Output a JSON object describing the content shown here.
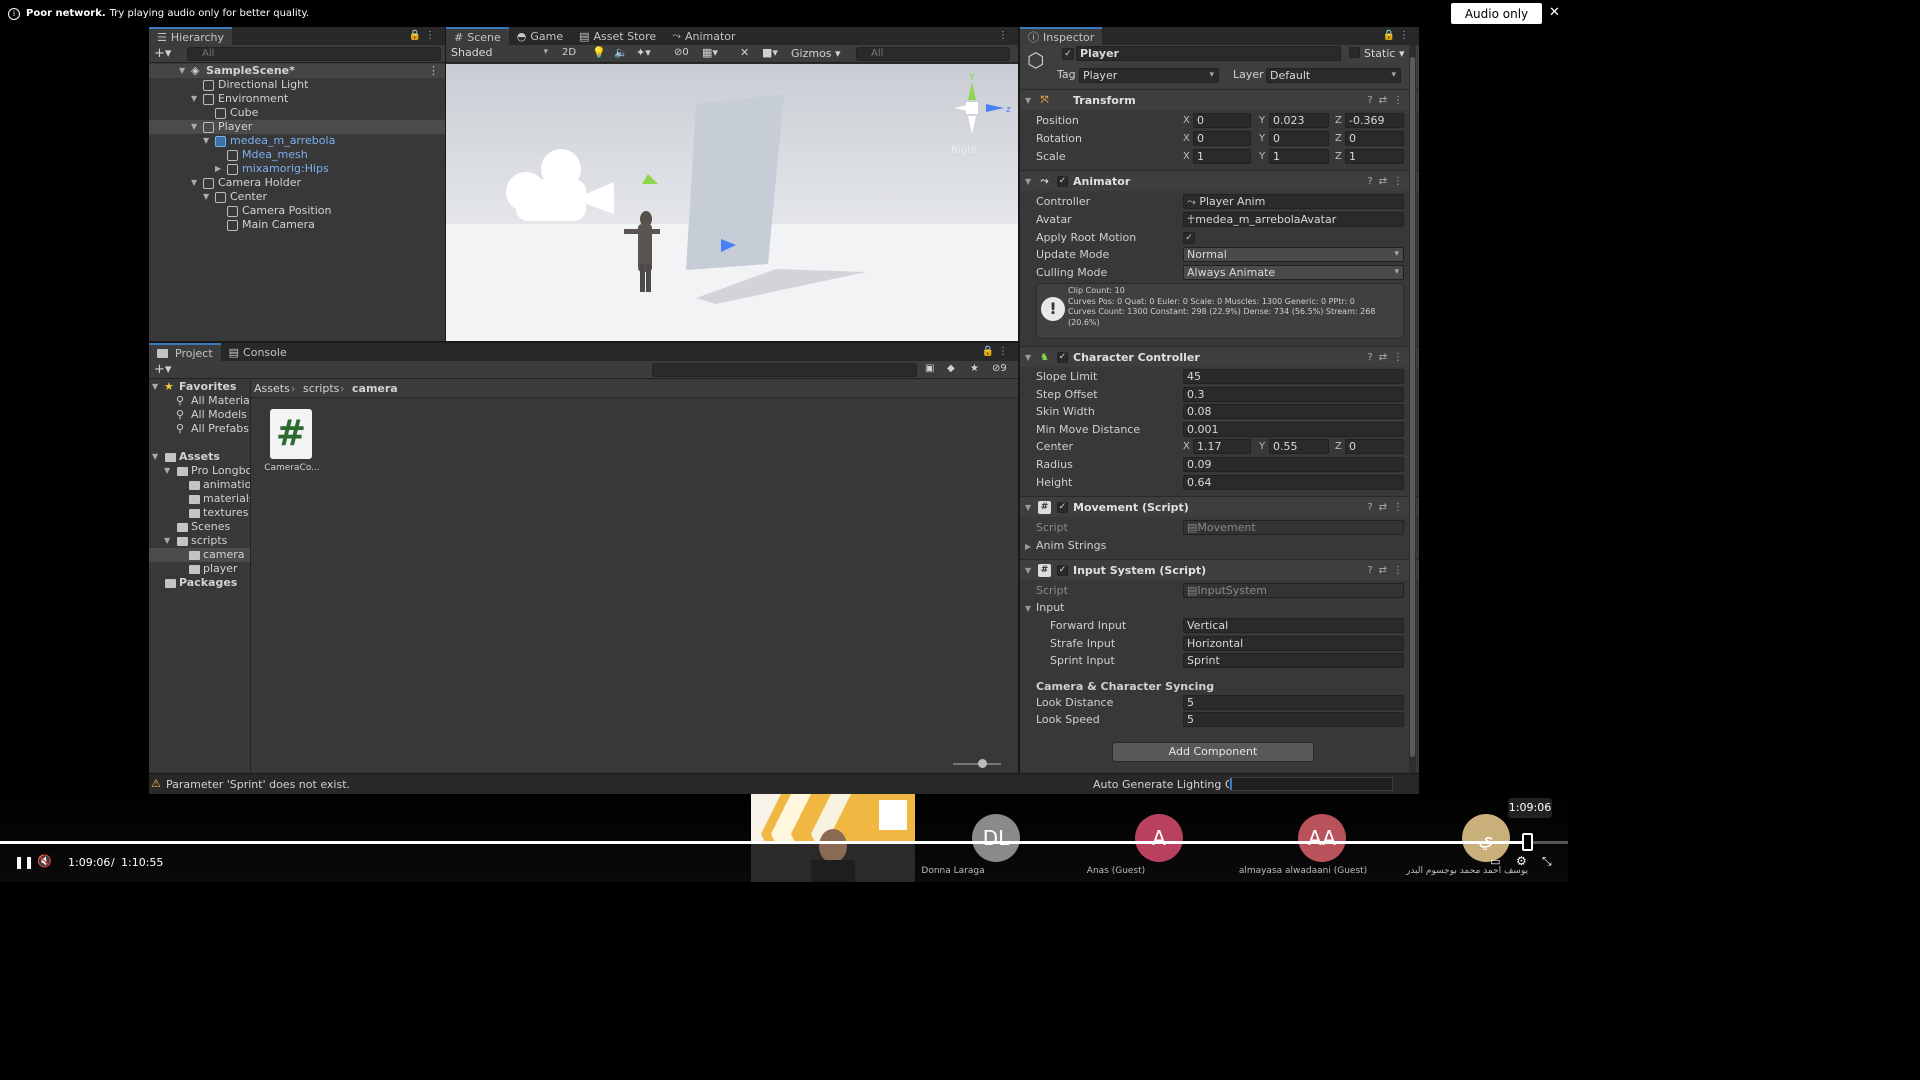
{
  "notice": {
    "bold": "Poor network.",
    "text": "Try playing audio only for better quality.",
    "button": "Audio only",
    "close": "✕"
  },
  "hierarchy": {
    "tab": "Hierarchy",
    "search_placeholder": "All",
    "items": [
      {
        "label": "SampleScene*"
      },
      {
        "label": "Directional Light"
      },
      {
        "label": "Environment"
      },
      {
        "label": "Cube"
      },
      {
        "label": "Player"
      },
      {
        "label": "medea_m_arrebola"
      },
      {
        "label": "Mdea_mesh"
      },
      {
        "label": "mixamorig:Hips"
      },
      {
        "label": "Camera Holder"
      },
      {
        "label": "Center"
      },
      {
        "label": "Camera Position"
      },
      {
        "label": "Main Camera"
      }
    ]
  },
  "scene": {
    "tabs": [
      "Scene",
      "Game",
      "Asset Store",
      "Animator"
    ],
    "shading": "Shaded",
    "mode_2d": "2D",
    "layers_count": "0",
    "gizmos": "Gizmos",
    "search_placeholder": "All",
    "view_label": "Right"
  },
  "project": {
    "tabs": [
      "Project",
      "Console"
    ],
    "hidden_count": "9",
    "favorites": {
      "label": "Favorites",
      "items": [
        "All Materials",
        "All Models",
        "All Prefabs"
      ]
    },
    "assets": {
      "label": "Assets",
      "pro": "Pro Longbow",
      "pro_children": [
        "animations",
        "materials",
        "textures"
      ],
      "scenes": "Scenes",
      "scripts": "scripts",
      "script_children": [
        "camera",
        "player"
      ]
    },
    "packages": "Packages",
    "breadcrumb": [
      "Assets",
      "scripts",
      "camera"
    ],
    "file": {
      "name": "CameraCo...",
      "glyph": "#"
    }
  },
  "inspector": {
    "tab": "Inspector",
    "object_name": "Player",
    "static_label": "Static",
    "tag_label": "Tag",
    "tag_value": "Player",
    "layer_label": "Layer",
    "layer_value": "Default",
    "transform": {
      "title": "Transform",
      "position": {
        "label": "Position",
        "x": "0",
        "y": "0.023",
        "z": "-0.369"
      },
      "rotation": {
        "label": "Rotation",
        "x": "0",
        "y": "0",
        "z": "0"
      },
      "scale": {
        "label": "Scale",
        "x": "1",
        "y": "1",
        "z": "1"
      }
    },
    "animator": {
      "title": "Animator",
      "controller_label": "Controller",
      "controller": "Player Anim",
      "avatar_label": "Avatar",
      "avatar": "medea_m_arrebolaAvatar",
      "root_motion_label": "Apply Root Motion",
      "update_mode_label": "Update Mode",
      "update_mode": "Normal",
      "culling_mode_label": "Culling Mode",
      "culling_mode": "Always Animate",
      "info": [
        "Clip Count: 10",
        "Curves Pos: 0 Quat: 0 Euler: 0 Scale: 0 Muscles: 1300 Generic: 0 PPtr: 0",
        "Curves Count: 1300 Constant: 298 (22.9%) Dense: 734 (56.5%) Stream: 268",
        "(20.6%)"
      ]
    },
    "character_controller": {
      "title": "Character Controller",
      "slope_limit": {
        "label": "Slope Limit",
        "value": "45"
      },
      "step_offset": {
        "label": "Step Offset",
        "value": "0.3"
      },
      "skin_width": {
        "label": "Skin Width",
        "value": "0.08"
      },
      "min_move": {
        "label": "Min Move Distance",
        "value": "0.001"
      },
      "center": {
        "label": "Center",
        "x": "1.17",
        "y": "0.55",
        "z": "0"
      },
      "radius": {
        "label": "Radius",
        "value": "0.09"
      },
      "height": {
        "label": "Height",
        "value": "0.64"
      }
    },
    "movement": {
      "title": "Movement (Script)",
      "script_label": "Script",
      "script": "Movement",
      "anim_strings": "Anim Strings"
    },
    "input_system": {
      "title": "Input System (Script)",
      "script_label": "Script",
      "script": "InputSystem",
      "input_label": "Input",
      "forward": {
        "label": "Forward Input",
        "value": "Vertical"
      },
      "strafe": {
        "label": "Strafe Input",
        "value": "Horizontal"
      },
      "sprint": {
        "label": "Sprint Input",
        "value": "Sprint"
      },
      "sync_header": "Camera & Character Syncing",
      "look_distance": {
        "label": "Look Distance",
        "value": "5"
      },
      "look_speed": {
        "label": "Look Speed",
        "value": "5"
      }
    },
    "add_component": "Add Component"
  },
  "status": {
    "warning": "Parameter 'Sprint' does not exist.",
    "lighting": "Auto Generate Lighting Off"
  },
  "player": {
    "current": "1:09:06",
    "separator": "/",
    "total": "1:10:55",
    "tooltip": "1:09:06",
    "progress": 0.9741,
    "participants": [
      {
        "initials": "DL",
        "name": "Donna Laraga",
        "color": "#8a8a8a"
      },
      {
        "initials": "A",
        "name": "Anas (Guest)",
        "color": "#b9415f"
      },
      {
        "initials": "AA",
        "name": "almayasa alwadaani (Guest)",
        "color": "#b9525b"
      },
      {
        "initials": "ي",
        "name": "يوسف احمد محمد بوجسوم البدر",
        "color": "#c9b07a"
      }
    ]
  },
  "colors": {
    "accent": "#3a79bb",
    "bg": "#383838",
    "link": "#7bb0ef"
  }
}
